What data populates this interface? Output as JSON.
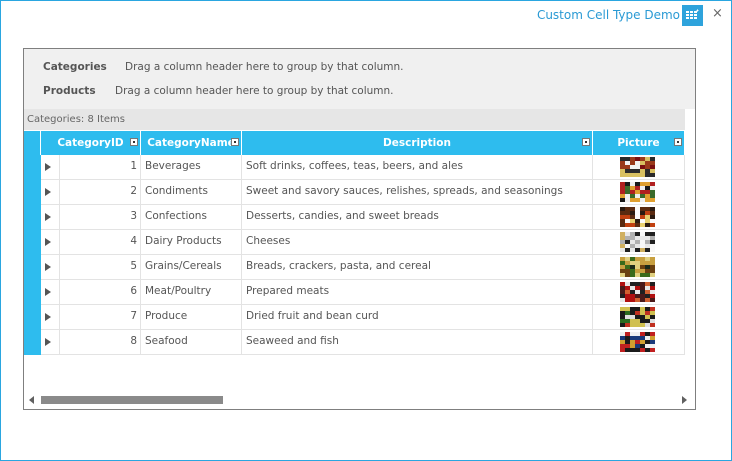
{
  "window": {
    "title": "Custom Cell Type Demo",
    "accent": "#2aa6e0",
    "close_glyph": "×"
  },
  "group_panel": {
    "levels": [
      {
        "label": "Categories",
        "hint": "Drag a column header here to group by that column."
      },
      {
        "label": "Products",
        "hint": "Drag a column header here to group by that column."
      }
    ]
  },
  "band_info": "Categories: 8 Items",
  "columns": [
    {
      "label": "CategoryID"
    },
    {
      "label": "CategoryName"
    },
    {
      "label": "Description"
    },
    {
      "label": "Picture"
    }
  ],
  "rows": [
    {
      "id": "1",
      "name": "Beverages",
      "description": "Soft drinks, coffees, teas, beers, and ales"
    },
    {
      "id": "2",
      "name": "Condiments",
      "description": "Sweet and savory sauces, relishes, spreads, and seasonings"
    },
    {
      "id": "3",
      "name": "Confections",
      "description": "Desserts, candies, and sweet breads"
    },
    {
      "id": "4",
      "name": "Dairy Products",
      "description": "Cheeses"
    },
    {
      "id": "5",
      "name": "Grains/Cereals",
      "description": "Breads, crackers, pasta, and cereal"
    },
    {
      "id": "6",
      "name": "Meat/Poultry",
      "description": "Prepared meats"
    },
    {
      "id": "7",
      "name": "Produce",
      "description": "Dried fruit and bean curd"
    },
    {
      "id": "8",
      "name": "Seafood",
      "description": "Seaweed and fish"
    }
  ],
  "icons": {
    "grid_button": "grid-menu-icon",
    "expander": "expand-arrow-icon",
    "picture": "category-picture-icon",
    "scroll_left": "scroll-left-arrow-icon",
    "scroll_right": "scroll-right-arrow-icon"
  },
  "colors": {
    "header_bg": "#2ebcee",
    "band_bg": "#e6e6e6",
    "group_bg": "#f0f0f0"
  }
}
